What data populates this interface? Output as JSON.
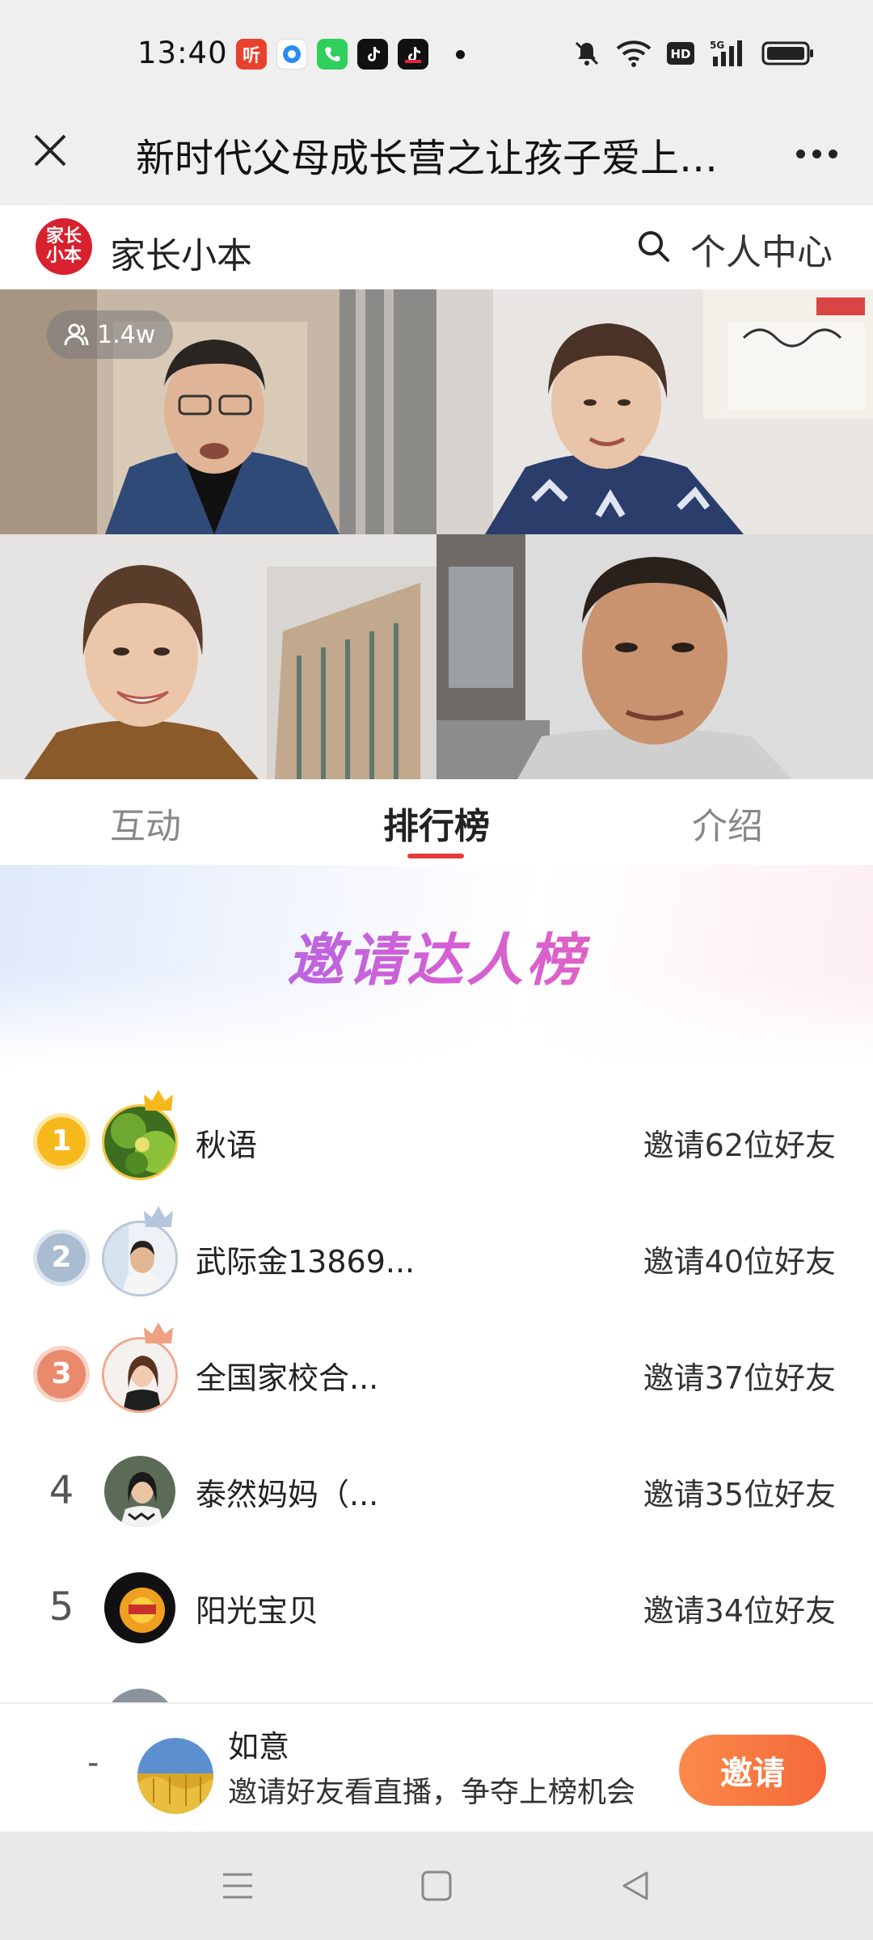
{
  "status_bar": {
    "time": "13:40",
    "app_icons": [
      "ting-icon",
      "browser-icon",
      "phone-icon",
      "tiktok-icon",
      "tiktok-lite-icon"
    ],
    "system_icons": [
      "mute-icon",
      "wifi-icon",
      "hd-icon",
      "5g-signal-icon",
      "battery-icon"
    ]
  },
  "title_bar": {
    "title": "新时代父母成长营之让孩子爱上学习"
  },
  "brand_bar": {
    "logo_text": "家长小本",
    "brand_name": "家长小本",
    "personal_center": "个人中心",
    "accent_color": "#d8202e"
  },
  "video": {
    "viewer_count": "1.4w"
  },
  "tabs": [
    {
      "label": "互动",
      "active": false
    },
    {
      "label": "排行榜",
      "active": true
    },
    {
      "label": "介绍",
      "active": false
    }
  ],
  "ranking": {
    "title": "邀请达人榜",
    "rows": [
      {
        "rank": "1",
        "name": "秋语",
        "count": "邀请62位好友"
      },
      {
        "rank": "2",
        "name": "武际金13869...",
        "count": "邀请40位好友"
      },
      {
        "rank": "3",
        "name": "全国家校合...",
        "count": "邀请37位好友"
      },
      {
        "rank": "4",
        "name": "泰然妈妈（...",
        "count": "邀请35位好友"
      },
      {
        "rank": "5",
        "name": "阳光宝贝",
        "count": "邀请34位好友"
      }
    ]
  },
  "my_rank": {
    "rank": "-",
    "name": "如意",
    "hint": "邀请好友看直播，争夺上榜机会",
    "button": "邀请"
  },
  "colors": {
    "gold": "#f7b81b",
    "silver": "#a9bcd0",
    "bronze": "#ea8a6d",
    "tab_underline": "#e83a3a",
    "invite_button": "#f5683a"
  }
}
